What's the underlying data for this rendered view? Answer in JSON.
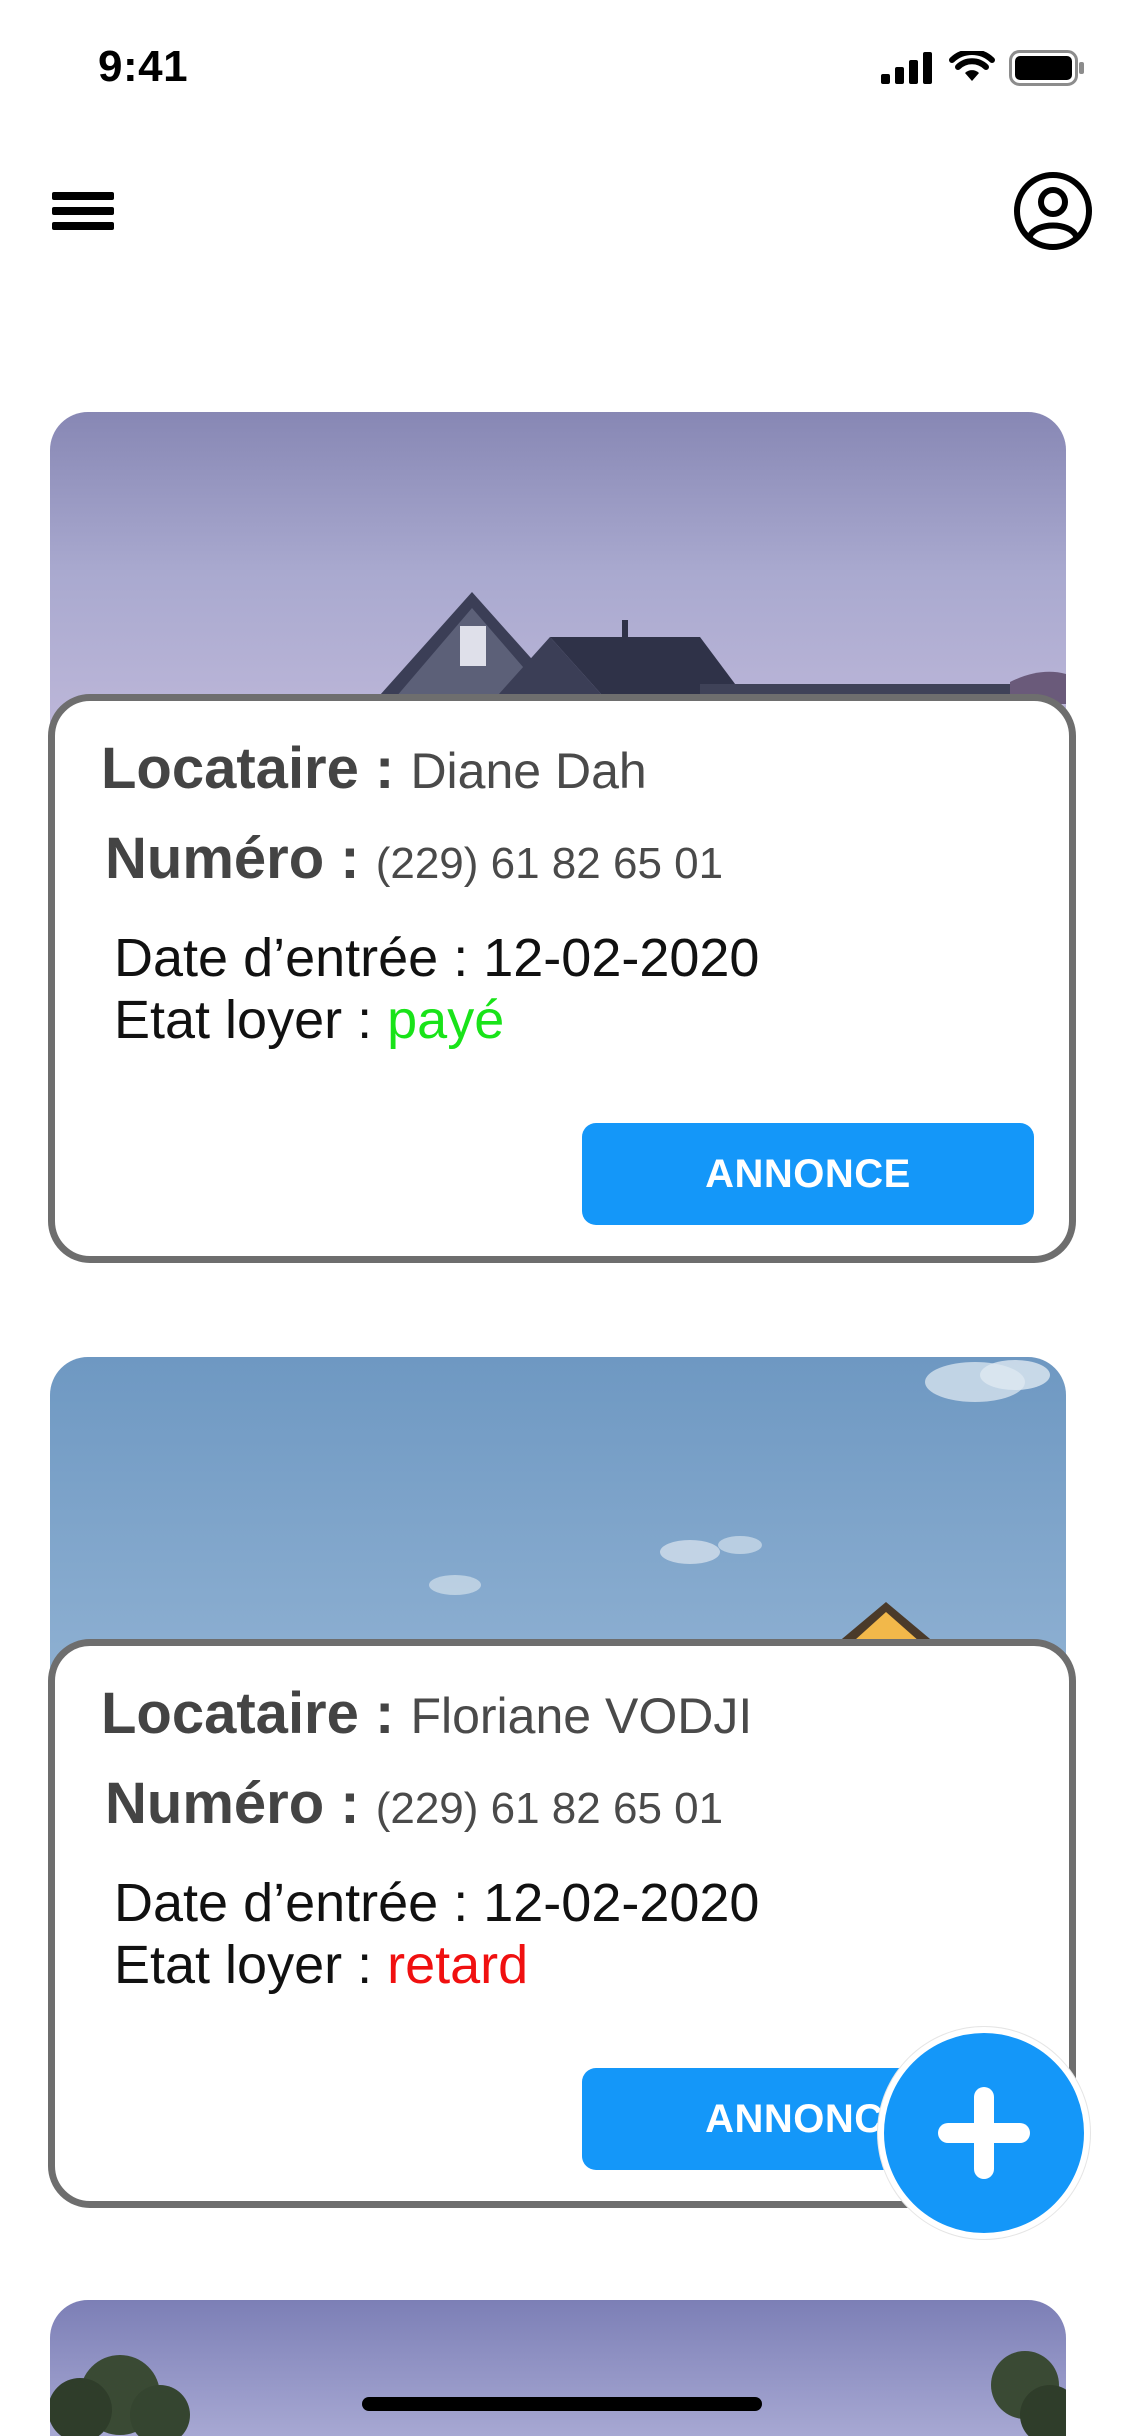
{
  "status_bar": {
    "time": "9:41",
    "icons": [
      "signal-icon",
      "wifi-icon",
      "battery-icon"
    ]
  },
  "header": {
    "menu_icon": "hamburger-menu-icon",
    "profile_icon": "user-circle-icon"
  },
  "labels": {
    "tenant": "Locataire :",
    "number": "Numéro :",
    "entry_date": "Date d’entrée :",
    "rent_status": "Etat loyer :"
  },
  "properties": [
    {
      "tenant_name": "Diane Dah",
      "phone": "(229) 61 82 65 01",
      "entry_date": "12-02-2020",
      "rent_status": "payé",
      "rent_status_color": "#19e319",
      "button_label": "ANNONCE"
    },
    {
      "tenant_name": "Floriane VODJI",
      "phone": "(229) 61 82 65 01",
      "entry_date": "12-02-2020",
      "rent_status": "retard",
      "rent_status_color": "#f01010",
      "button_label": "ANNONCE"
    }
  ],
  "fab": {
    "icon": "plus-icon"
  },
  "colors": {
    "accent": "#1497f9",
    "card_border": "#6e6e6e"
  }
}
